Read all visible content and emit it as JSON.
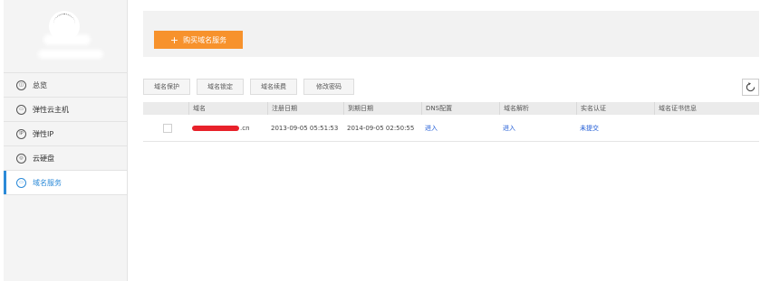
{
  "sidebar": {
    "items": [
      {
        "label": "总览",
        "icon": "dashboard-icon",
        "glyph": "◫"
      },
      {
        "label": "弹性云主机",
        "icon": "server-icon",
        "glyph": "▭"
      },
      {
        "label": "弹性IP",
        "icon": "ip-icon",
        "glyph": "IP"
      },
      {
        "label": "云硬盘",
        "icon": "disk-icon",
        "glyph": "◎"
      },
      {
        "label": "域名服务",
        "icon": "domain-icon",
        "glyph": "▭"
      }
    ],
    "active_index": 4,
    "accent": "#2b8ad8"
  },
  "banner": {
    "buy_button": {
      "label": "购买域名服务",
      "icon": "plus-icon",
      "color": "#f7922c"
    }
  },
  "toolbar": {
    "buttons": [
      "域名保护",
      "域名锁定",
      "域名续费",
      "修改密码"
    ],
    "refresh_icon": "refresh-icon"
  },
  "table": {
    "columns": [
      "域名",
      "注册日期",
      "到期日期",
      "DNS配置",
      "域名解析",
      "实名认证",
      "域名证书信息"
    ],
    "rows": [
      {
        "domain_suffix": ".cn",
        "registered": "2013-09-05 05:51:53",
        "expires": "2014-09-05 02:50:55",
        "dns": "进入",
        "resolve": "进入",
        "verify": "未提交",
        "cert": ""
      }
    ]
  }
}
